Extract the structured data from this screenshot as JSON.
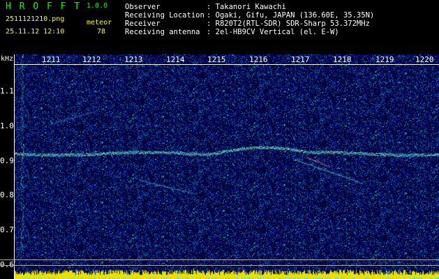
{
  "app": {
    "title": "H R O F F T",
    "version": "1.0.0",
    "filename": "2511121210.png",
    "mode": "meteor",
    "datetime": "25.11.12 12:10",
    "count": "78"
  },
  "info": {
    "labels": [
      "Observer",
      "Receiving Location",
      "Receiver",
      "Receiving antenna"
    ],
    "values": [
      ": Takanori Kawachi",
      ": Ogaki, Gifu, JAPAN (136.60E, 35.35N)",
      ": R820T2(RTL-SDR) SDR-Sharp 53.372MHz",
      ": 2el-HB9CV Vertical (el. E-W)"
    ]
  },
  "axis": {
    "y_unit": "kHz",
    "y_ticks": [
      "1.1",
      "1.0",
      "0.9",
      "0.8",
      "0.7",
      "0.6"
    ],
    "x_ticks": [
      "1211",
      "1212",
      "1213",
      "1214",
      "1215",
      "1216",
      "1217",
      "1218",
      "1219",
      "1220"
    ]
  },
  "colors": {
    "title": "#00ff00",
    "text": "#ffffff",
    "background": "#000000",
    "noise_base": "#000060",
    "echo": "#00ffff",
    "hot": "#ff8080",
    "strip": "#ffff00"
  }
}
